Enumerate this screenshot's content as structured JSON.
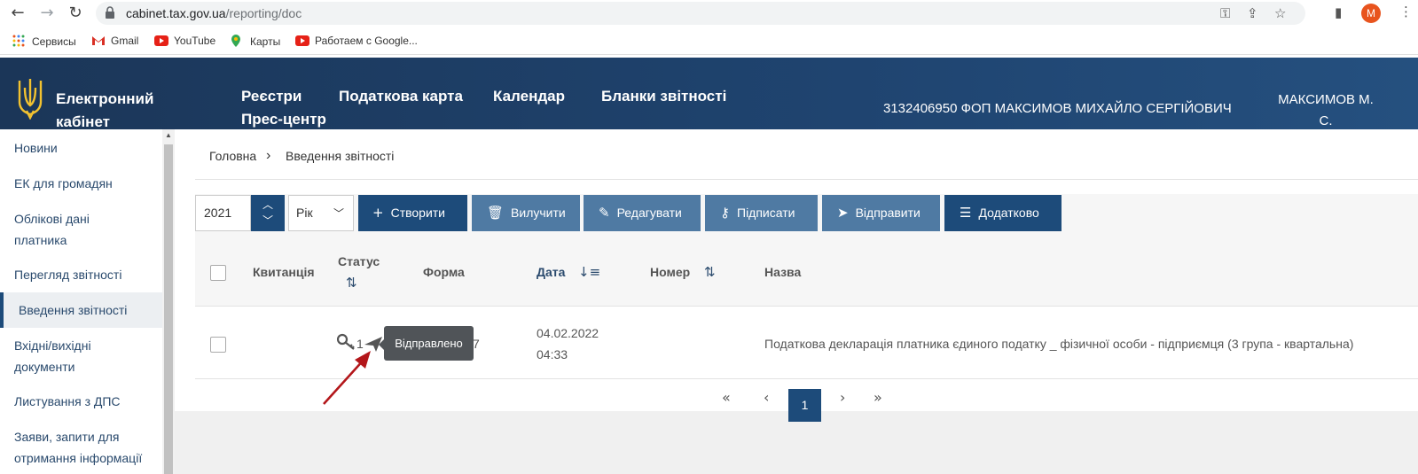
{
  "browser": {
    "url_host": "cabinet.tax.gov.ua",
    "url_path": "/reporting/doc",
    "profile_initial": "M",
    "bookmarks": [
      "Сервисы",
      "Gmail",
      "YouTube",
      "Карты",
      "Работаем с Google..."
    ]
  },
  "header": {
    "logo_line1": "Електронний",
    "logo_line2": "кабінет",
    "nav": [
      "Реєстри",
      "Податкова карта",
      "Календар",
      "Бланки звітності",
      "Прес-центр"
    ],
    "taxpayer": "3132406950 ФОП МАКСИМОВ МИХАЙЛО СЕРГІЙОВИЧ",
    "user_short_1": "МАКСИМОВ М.",
    "user_short_2": "С."
  },
  "sidebar": {
    "items": [
      {
        "line1": "Новини",
        "line2": ""
      },
      {
        "line1": "ЕК для громадян",
        "line2": ""
      },
      {
        "line1": "Облікові дані",
        "line2": "платника"
      },
      {
        "line1": "Перегляд звітності",
        "line2": ""
      },
      {
        "line1": "Введення звітності",
        "line2": ""
      },
      {
        "line1": "Вхідні/вихідні",
        "line2": "документи"
      },
      {
        "line1": "Листування з ДПС",
        "line2": ""
      },
      {
        "line1": "Заяви, запити для",
        "line2": "отримання інформації"
      }
    ]
  },
  "breadcrumb": {
    "home": "Головна",
    "current": "Введення звітності"
  },
  "toolbar": {
    "year": "2021",
    "period": "Рік",
    "create": "Створити",
    "delete": "Вилучити",
    "edit": "Редагувати",
    "sign": "Підписати",
    "send": "Відправити",
    "more": "Додатково"
  },
  "table": {
    "headers": {
      "receipt": "Квитанція",
      "status": "Статус",
      "form": "Форма",
      "date": "Дата",
      "number": "Номер",
      "name": "Назва"
    },
    "rows": [
      {
        "status_num": "1",
        "form_tail": "7",
        "date": "04.02.2022",
        "time": "04:33",
        "name": "Податкова декларація платника єдиного податку _ фізичної особи - підприємця (3 група - квартальна)"
      }
    ]
  },
  "tooltip": "Відправлено",
  "pagination": {
    "current": "1",
    "first": "«",
    "prev": "‹",
    "next": "›",
    "last": "»"
  },
  "colors": {
    "primary": "#1d4b7a",
    "secondary": "#4f7aa3",
    "annotation": "#b3161a"
  }
}
